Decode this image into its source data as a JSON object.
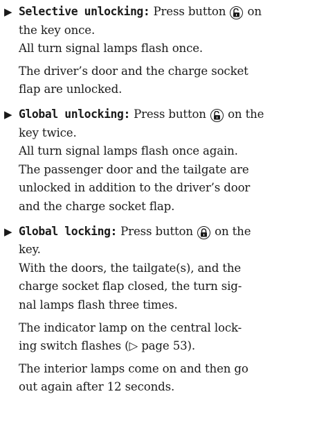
{
  "items": [
    {
      "heading": "Selective unlocking:",
      "line1_pre": "Press button",
      "icon": "unlock-icon",
      "line1_post": "on",
      "lines": [
        "the key once.",
        "All turn signal lamps flash once."
      ],
      "para2": [
        "The driver’s door and the charge socket",
        "flap are unlocked."
      ]
    },
    {
      "heading": "Global unlocking:",
      "line1_pre": "Press button",
      "icon": "unlock-icon",
      "line1_post": "on the",
      "lines": [
        "key twice.",
        "All turn signal lamps flash once again.",
        "The passenger door and the tailgate are",
        "unlocked in addition to the driver’s door",
        "and the charge socket flap."
      ]
    },
    {
      "heading": "Global locking:",
      "line1_pre": "Press button",
      "icon": "lock-icon",
      "line1_post": "on the",
      "lines": [
        "key.",
        "With the doors, the tailgate(s), and the",
        "charge socket flap closed, the turn sig-",
        "nal lamps flash three times."
      ],
      "para2": [
        "The indicator lamp on the central lock-",
        "ing switch flashes (▷ page 53)."
      ],
      "para3": [
        "The interior lamps come on and then go",
        "out again after 12 seconds."
      ]
    }
  ]
}
